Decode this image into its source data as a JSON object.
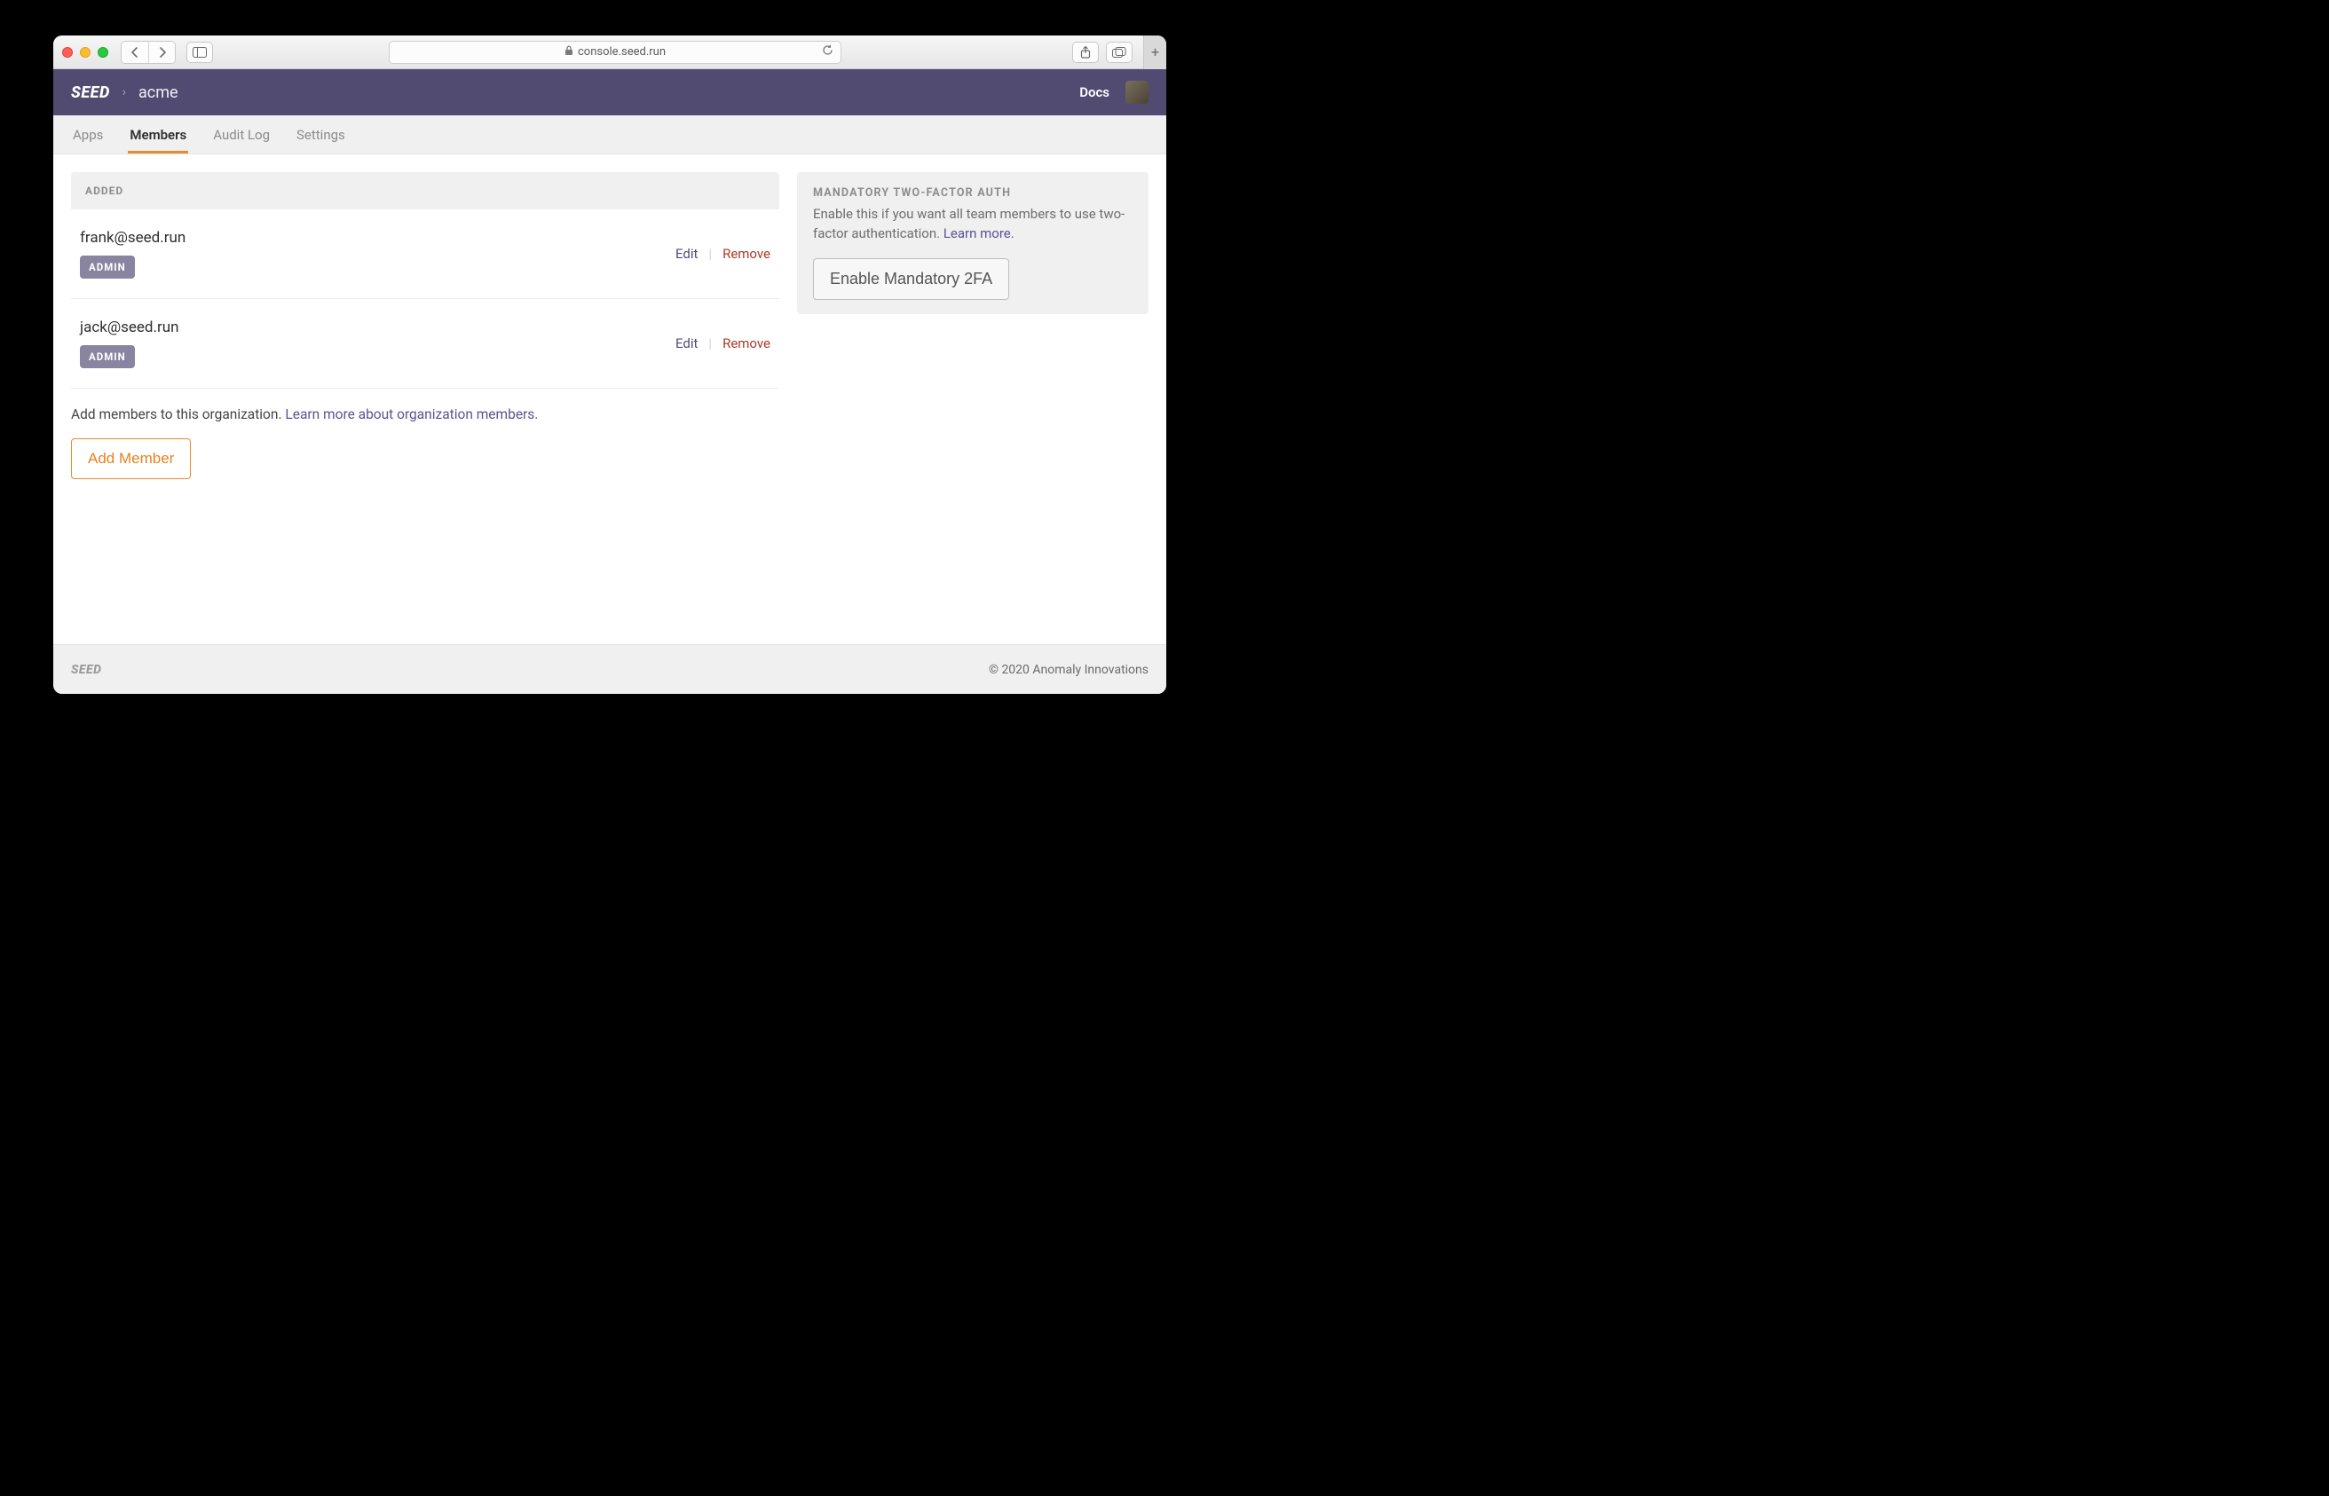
{
  "browser": {
    "url": "console.seed.run"
  },
  "header": {
    "logo": "SEED",
    "org": "acme",
    "docs": "Docs"
  },
  "tabs": [
    {
      "label": "Apps",
      "active": false
    },
    {
      "label": "Members",
      "active": true
    },
    {
      "label": "Audit Log",
      "active": false
    },
    {
      "label": "Settings",
      "active": false
    }
  ],
  "members": {
    "section_title": "ADDED",
    "rows": [
      {
        "email": "frank@seed.run",
        "role": "ADMIN",
        "edit": "Edit",
        "remove": "Remove"
      },
      {
        "email": "jack@seed.run",
        "role": "ADMIN",
        "edit": "Edit",
        "remove": "Remove"
      }
    ],
    "help_text": "Add members to this organization. ",
    "help_link": "Learn more about organization members.",
    "add_button": "Add Member"
  },
  "two_factor": {
    "title": "MANDATORY TWO-FACTOR AUTH",
    "desc": "Enable this if you want all team members to use two-factor authentication. ",
    "learn_more": "Learn more.",
    "button": "Enable Mandatory 2FA"
  },
  "footer": {
    "logo": "SEED",
    "copyright": "© 2020 Anomaly Innovations"
  }
}
